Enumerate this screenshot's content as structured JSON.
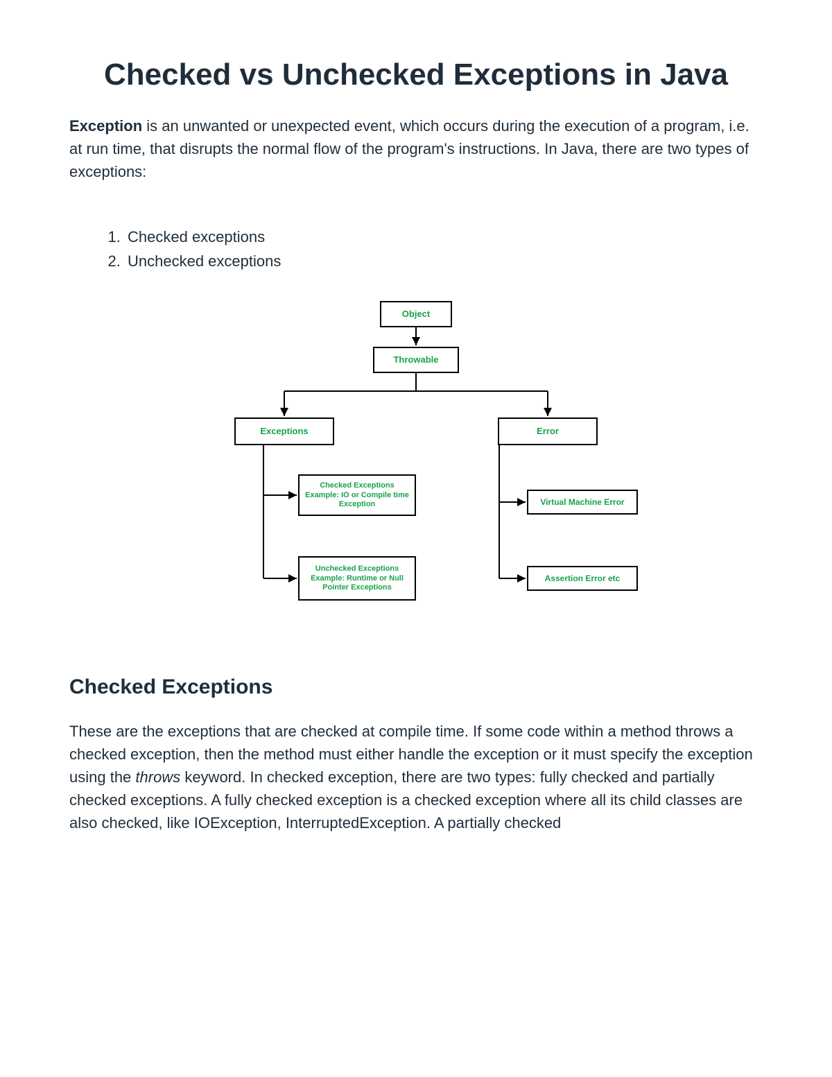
{
  "title": "Checked vs Unchecked Exceptions in Java",
  "intro": {
    "strong": "Exception",
    "rest": " is an unwanted or unexpected event, which occurs during the execution of a program, i.e. at run time, that disrupts the normal flow of the program's instructions. In Java, there are two types of exceptions:"
  },
  "list": {
    "item1": "Checked exceptions",
    "item2": "Unchecked exceptions"
  },
  "diagram": {
    "object": "Object",
    "throwable": "Throwable",
    "exceptions": "Exceptions",
    "error": "Error",
    "checked": "Checked Exceptions Example: IO or Compile time Exception",
    "unchecked": "Unchecked Exceptions Example: Runtime or Null Pointer Exceptions",
    "vm_error": "Virtual Machine Error",
    "assert_error": "Assertion Error etc"
  },
  "section1": {
    "heading": "Checked Exceptions",
    "p_before_italic": "These are the exceptions that are checked at compile time. If some code within a method throws a checked exception, then the method must either handle the exception or it must specify the exception using the ",
    "italic": "throws",
    "p_after_italic": " keyword. In checked exception, there are two types: fully checked and partially checked exceptions. A fully checked exception is a checked exception where all its child classes are also checked, like IOException, InterruptedException. A partially checked"
  }
}
